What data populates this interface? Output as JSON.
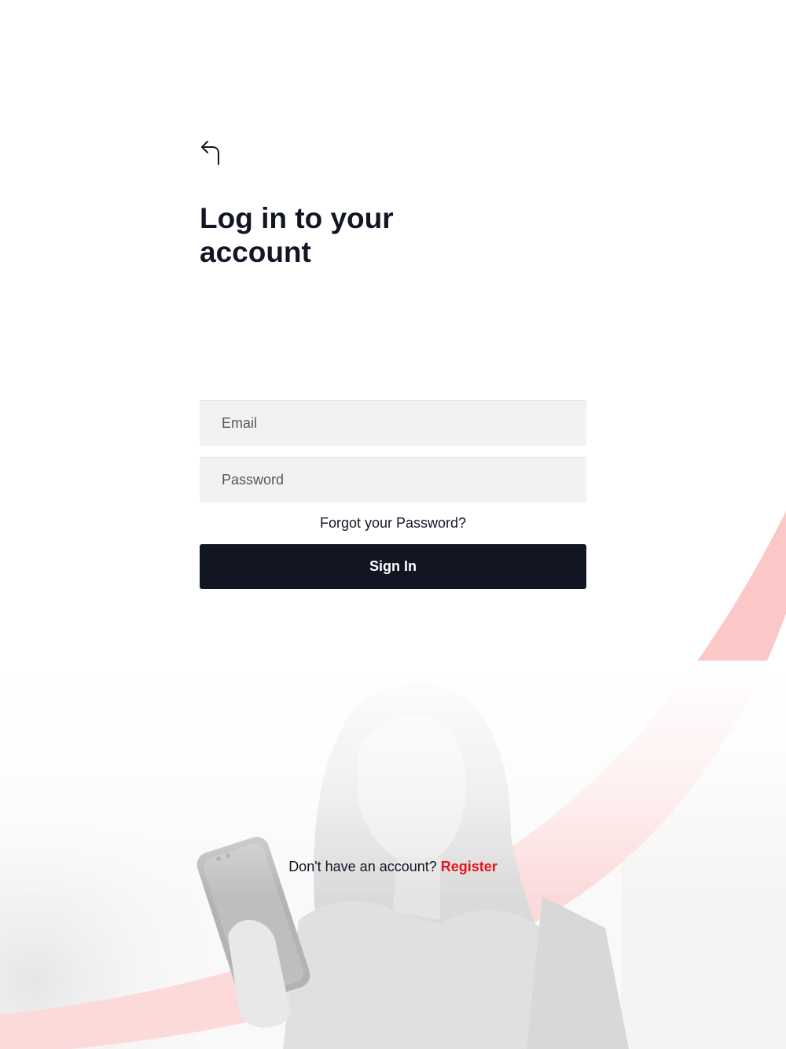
{
  "header": {
    "back_icon": "back-arrow-icon",
    "title": "Log in to your account"
  },
  "form": {
    "email_placeholder": "Email",
    "password_placeholder": "Password",
    "forgot_password_label": "Forgot your Password?",
    "signin_label": "Sign In"
  },
  "footer": {
    "prompt": "Don't have an account?",
    "register_label": "Register"
  },
  "colors": {
    "primary_dark": "#121623",
    "accent_red": "#e4141b",
    "swoosh_pink": "#fbc7c7",
    "field_bg": "#f2f2f2"
  }
}
